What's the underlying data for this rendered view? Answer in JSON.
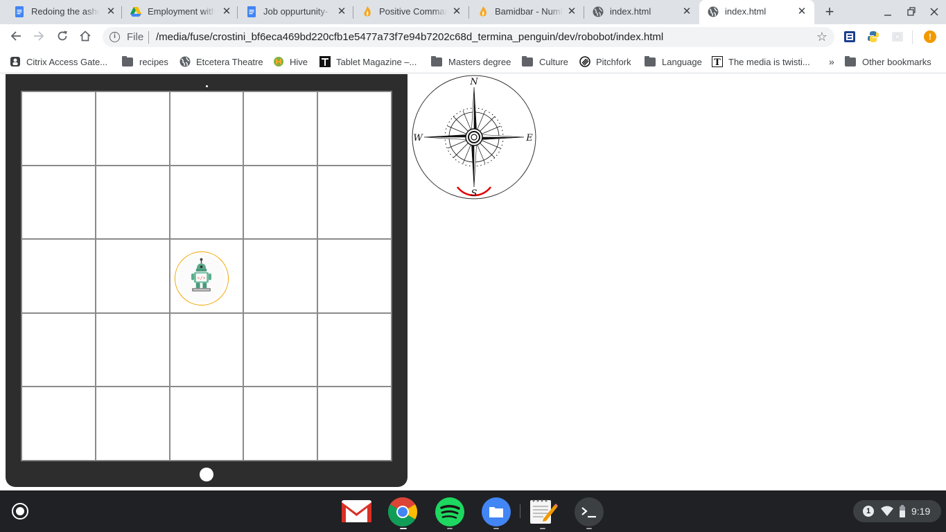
{
  "browser": {
    "tabs": [
      {
        "title": "Redoing the ashes",
        "icon": "docs-icon"
      },
      {
        "title": "Employment with",
        "icon": "drive-icon"
      },
      {
        "title": "Job oppurtunity- v",
        "icon": "docs-icon"
      },
      {
        "title": "Positive Comman",
        "icon": "flame-icon"
      },
      {
        "title": "Bamidbar - Numb",
        "icon": "flame-icon"
      },
      {
        "title": "index.html",
        "icon": "globe-icon"
      },
      {
        "title": "index.html",
        "icon": "globe-icon",
        "active": true
      }
    ],
    "address": {
      "scheme": "File",
      "url": "/media/fuse/crostini_bf6eca469bd220cfb1e5477a73f7e94b7202c68d_termina_penguin/dev/robobot/index.html"
    },
    "bookmarks": [
      {
        "label": "Citrix Access Gate...",
        "icon": "citrix-icon"
      },
      {
        "label": "recipes",
        "icon": "folder-icon"
      },
      {
        "label": "Etcetera Theatre",
        "icon": "globe-icon"
      },
      {
        "label": "Hive",
        "icon": "hive-icon"
      },
      {
        "label": "Tablet Magazine –...",
        "icon": "tablet-t-icon"
      },
      {
        "label": "Masters degree",
        "icon": "folder-icon"
      },
      {
        "label": "Culture",
        "icon": "folder-icon"
      },
      {
        "label": "Pitchfork",
        "icon": "pitchfork-icon"
      },
      {
        "label": "Language",
        "icon": "folder-icon"
      },
      {
        "label": "The media is twisti...",
        "icon": "nyt-icon"
      }
    ],
    "bookmarks_overflow": "»",
    "other_bookmarks": "Other bookmarks",
    "profile_alert": "!"
  },
  "page": {
    "grid": {
      "rows": 5,
      "cols": 5,
      "robot_cell": {
        "row": 3,
        "col": 3
      }
    },
    "compass": {
      "north": "N",
      "south": "S",
      "east": "E",
      "west": "W",
      "heading": "S",
      "heading_color": "#e00000"
    }
  },
  "shelf": {
    "apps": [
      "gmail-icon",
      "chrome-icon",
      "spotify-icon",
      "files-icon",
      "text-editor-icon",
      "terminal-icon"
    ],
    "notification_count": "1",
    "time": "9:19"
  }
}
